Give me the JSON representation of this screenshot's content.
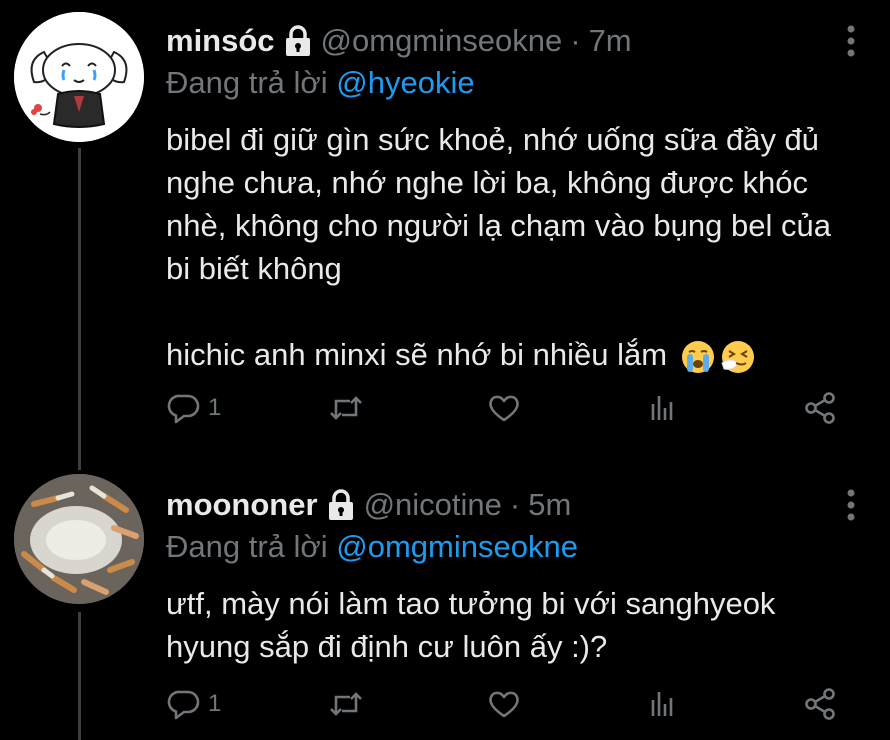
{
  "colors": {
    "background": "#000000",
    "text": "#e7e9ea",
    "muted": "#71767b",
    "mention": "#1d9bf0",
    "thread_line": "#3a3f44"
  },
  "tweets": [
    {
      "display_name": "minsóc",
      "handle": "@omgminseokne",
      "dot": "·",
      "time": "7m",
      "reply_prefix": "Đang trả lời",
      "reply_to": "@hyeokie",
      "text_lines": [
        "bibel đi giữ gìn sức khoẻ, nhớ uống sữa đầy đủ nghe chưa, nhớ nghe lời ba, không được khóc nhè, không cho người lạ chạm vào bụng bel của bi biết không",
        "hichic anh minxi sẽ nhớ bi nhiều lắm"
      ],
      "emojis": [
        "loudly-crying-face-emoji",
        "sneezing-face-emoji"
      ],
      "reply_count": "1",
      "avatar": "cartoon-dog-avatar"
    },
    {
      "display_name": "moononer",
      "handle": "@nicotine",
      "dot": "·",
      "time": "5m",
      "reply_prefix": "Đang trả lời",
      "reply_to": "@omgminseokne",
      "text_lines": [
        "ưtf, mày nói làm tao tưởng bi với sanghyeok hyung sắp đi định cư luôn ấy :)?"
      ],
      "reply_count": "1",
      "avatar": "ashtray-photo-avatar"
    }
  ],
  "icons": {
    "lock": "lock-icon",
    "more": "more-vertical-icon",
    "reply": "reply-bubble-icon",
    "retweet": "retweet-icon",
    "like": "heart-icon",
    "stats": "analytics-icon",
    "share": "share-icon"
  }
}
